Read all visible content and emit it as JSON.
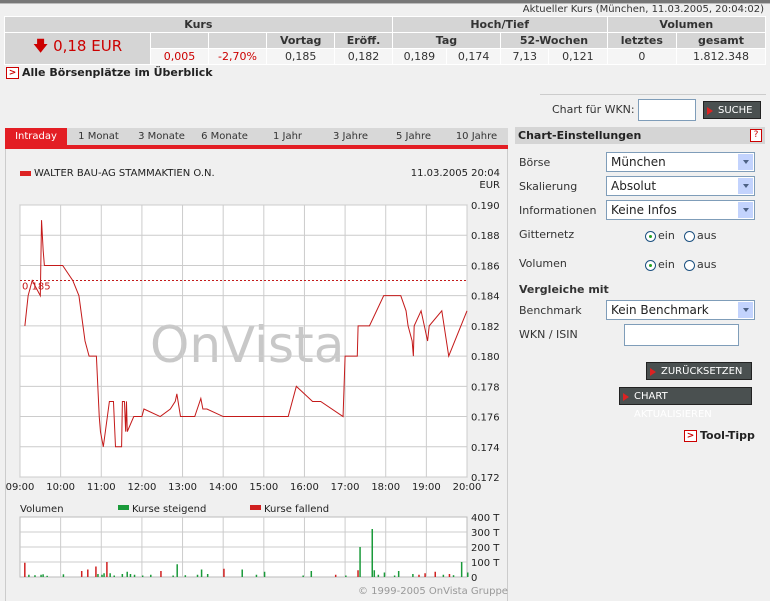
{
  "header": {
    "aktuell": "Aktueller Kurs (München, 11.03.2005, 20:04:02)"
  },
  "quote": {
    "group_kurs": "Kurs",
    "group_hochtief": "Hoch/Tief",
    "group_volumen": "Volumen",
    "col_vortag": "Vortag",
    "col_eroeff": "Eröff.",
    "col_tag": "Tag",
    "col_52w": "52-Wochen",
    "col_letztes": "letztes",
    "col_gesamt": "gesamt",
    "price": "0,18 EUR",
    "change_abs": "0,005",
    "change_pct": "-2,70%",
    "vortag": "0,185",
    "eroeff": "0,182",
    "tag_hoch": "0,189",
    "tag_tief": "0,174",
    "w52_hoch": "7,13",
    "w52_tief": "0,121",
    "vol_letztes": "0",
    "vol_gesamt": "1.812.348"
  },
  "links": {
    "alle": "Alle Börsenplätze im Überblick",
    "tooltipp": "Tool-Tipp",
    "arrow": ">",
    "help": "?"
  },
  "search": {
    "label": "Chart für WKN:",
    "value": "",
    "button": "SUCHE"
  },
  "tabs": [
    "Intraday",
    "1 Monat",
    "3 Monate",
    "6 Monate",
    "1 Jahr",
    "3 Jahre",
    "5 Jahre",
    "10 Jahre"
  ],
  "active_tab": "Intraday",
  "settings": {
    "title": "Chart-Einstellungen",
    "boerse_label": "Börse",
    "boerse": "München",
    "skal_label": "Skalierung",
    "skal": "Absolut",
    "info_label": "Informationen",
    "info": "Keine Infos",
    "gitter_label": "Gitternetz",
    "vol_label": "Volumen",
    "ein": "ein",
    "aus": "aus",
    "gitter_on": true,
    "vol_on": true,
    "vergleiche": "Vergleiche mit",
    "bench_label": "Benchmark",
    "bench": "Kein Benchmark",
    "wkn_label": "WKN / ISIN",
    "wkn_value": "",
    "reset": "ZURÜCKSETZEN",
    "update": "CHART AKTUALISIEREN"
  },
  "chart_data": {
    "type": "line",
    "title": "WALTER BAU-AG STAMMAKTIEN O.N.",
    "date": "11.03.2005 20:04",
    "currency": "EUR",
    "watermark": "OnVista",
    "xlim": [
      9,
      20
    ],
    "ylim": [
      0.172,
      0.19
    ],
    "xticks": [
      "09:00",
      "10:00",
      "11:00",
      "12:00",
      "13:00",
      "14:00",
      "15:00",
      "16:00",
      "17:00",
      "18:00",
      "19:00",
      "20:00"
    ],
    "yticks": [
      "0.190",
      "0.188",
      "0.186",
      "0.184",
      "0.182",
      "0.180",
      "0.178",
      "0.176",
      "0.174",
      "0.172"
    ],
    "reference": {
      "value": 0.185,
      "label": "0,185"
    },
    "series": [
      {
        "name": "Kurs",
        "color": "#c41a1a",
        "points": [
          [
            9.12,
            0.182
          ],
          [
            9.2,
            0.184
          ],
          [
            9.3,
            0.185
          ],
          [
            9.5,
            0.184
          ],
          [
            9.53,
            0.189
          ],
          [
            9.57,
            0.187
          ],
          [
            9.6,
            0.186
          ],
          [
            10.05,
            0.186
          ],
          [
            10.3,
            0.185
          ],
          [
            10.45,
            0.184
          ],
          [
            10.6,
            0.181
          ],
          [
            10.7,
            0.18
          ],
          [
            10.88,
            0.18
          ],
          [
            10.95,
            0.176
          ],
          [
            10.98,
            0.175
          ],
          [
            11.05,
            0.174
          ],
          [
            11.2,
            0.177
          ],
          [
            11.3,
            0.177
          ],
          [
            11.35,
            0.174
          ],
          [
            11.5,
            0.174
          ],
          [
            11.52,
            0.177
          ],
          [
            11.57,
            0.177
          ],
          [
            11.6,
            0.175
          ],
          [
            11.62,
            0.177
          ],
          [
            11.64,
            0.175
          ],
          [
            11.8,
            0.176
          ],
          [
            12.0,
            0.176
          ],
          [
            12.05,
            0.1765
          ],
          [
            12.45,
            0.176
          ],
          [
            12.7,
            0.1765
          ],
          [
            12.82,
            0.177
          ],
          [
            12.86,
            0.1775
          ],
          [
            12.95,
            0.176
          ],
          [
            13.3,
            0.176
          ],
          [
            13.45,
            0.1772
          ],
          [
            13.5,
            0.1765
          ],
          [
            13.6,
            0.1765
          ],
          [
            14.0,
            0.176
          ],
          [
            15.6,
            0.176
          ],
          [
            15.8,
            0.178
          ],
          [
            16.2,
            0.177
          ],
          [
            16.4,
            0.177
          ],
          [
            16.95,
            0.176
          ],
          [
            17.0,
            0.18
          ],
          [
            17.3,
            0.18
          ],
          [
            17.32,
            0.182
          ],
          [
            17.6,
            0.182
          ],
          [
            17.95,
            0.184
          ],
          [
            18.37,
            0.184
          ],
          [
            18.5,
            0.183
          ],
          [
            18.55,
            0.182
          ],
          [
            18.65,
            0.181
          ],
          [
            18.68,
            0.18
          ],
          [
            18.7,
            0.182
          ],
          [
            18.87,
            0.183
          ],
          [
            19.03,
            0.181
          ],
          [
            19.07,
            0.182
          ],
          [
            19.38,
            0.183
          ],
          [
            19.55,
            0.18
          ],
          [
            20.0,
            0.183
          ]
        ]
      }
    ],
    "volume": {
      "label": "Volumen",
      "legend_up": "Kurse steigend",
      "legend_down": "Kurse fallend",
      "color_up": "#1a9a3a",
      "color_down": "#d02020",
      "ylim": [
        0,
        400
      ],
      "yticks": [
        "400 T",
        "300 T",
        "200 T",
        "100 T",
        "0"
      ],
      "bars": [
        [
          9.1,
          95,
          "d"
        ],
        [
          9.2,
          15,
          "u"
        ],
        [
          9.35,
          12,
          "u"
        ],
        [
          9.5,
          15,
          "u"
        ],
        [
          9.55,
          18,
          "u"
        ],
        [
          9.65,
          8,
          "u"
        ],
        [
          10.05,
          18,
          "u"
        ],
        [
          10.5,
          40,
          "d"
        ],
        [
          10.65,
          50,
          "d"
        ],
        [
          10.85,
          70,
          "d"
        ],
        [
          10.9,
          20,
          "u"
        ],
        [
          11.0,
          15,
          "u"
        ],
        [
          11.05,
          25,
          "u"
        ],
        [
          11.12,
          100,
          "d"
        ],
        [
          11.2,
          25,
          "u"
        ],
        [
          11.3,
          10,
          "u"
        ],
        [
          11.5,
          20,
          "u"
        ],
        [
          11.62,
          35,
          "u"
        ],
        [
          11.7,
          20,
          "u"
        ],
        [
          11.8,
          15,
          "u"
        ],
        [
          12.0,
          10,
          "u"
        ],
        [
          12.2,
          15,
          "u"
        ],
        [
          12.45,
          40,
          "d"
        ],
        [
          12.75,
          10,
          "u"
        ],
        [
          12.85,
          85,
          "u"
        ],
        [
          13.05,
          12,
          "u"
        ],
        [
          13.35,
          15,
          "u"
        ],
        [
          13.45,
          50,
          "u"
        ],
        [
          13.6,
          20,
          "u"
        ],
        [
          14.0,
          55,
          "d"
        ],
        [
          14.45,
          50,
          "u"
        ],
        [
          14.8,
          15,
          "u"
        ],
        [
          15.0,
          35,
          "u"
        ],
        [
          15.95,
          10,
          "u"
        ],
        [
          16.15,
          40,
          "u"
        ],
        [
          16.75,
          15,
          "d"
        ],
        [
          17.0,
          10,
          "u"
        ],
        [
          17.3,
          45,
          "d"
        ],
        [
          17.35,
          200,
          "u"
        ],
        [
          17.65,
          320,
          "u"
        ],
        [
          17.7,
          45,
          "u"
        ],
        [
          17.8,
          15,
          "u"
        ],
        [
          17.95,
          30,
          "u"
        ],
        [
          18.2,
          10,
          "u"
        ],
        [
          18.3,
          40,
          "u"
        ],
        [
          18.65,
          20,
          "u"
        ],
        [
          18.8,
          15,
          "d"
        ],
        [
          18.95,
          25,
          "d"
        ],
        [
          19.2,
          35,
          "d"
        ],
        [
          19.4,
          15,
          "u"
        ],
        [
          19.55,
          20,
          "d"
        ],
        [
          19.65,
          12,
          "u"
        ],
        [
          19.85,
          100,
          "u"
        ],
        [
          20.0,
          30,
          "u"
        ]
      ]
    }
  },
  "footer": {
    "copyright": "© 1999-2005 OnVista Gruppe"
  }
}
